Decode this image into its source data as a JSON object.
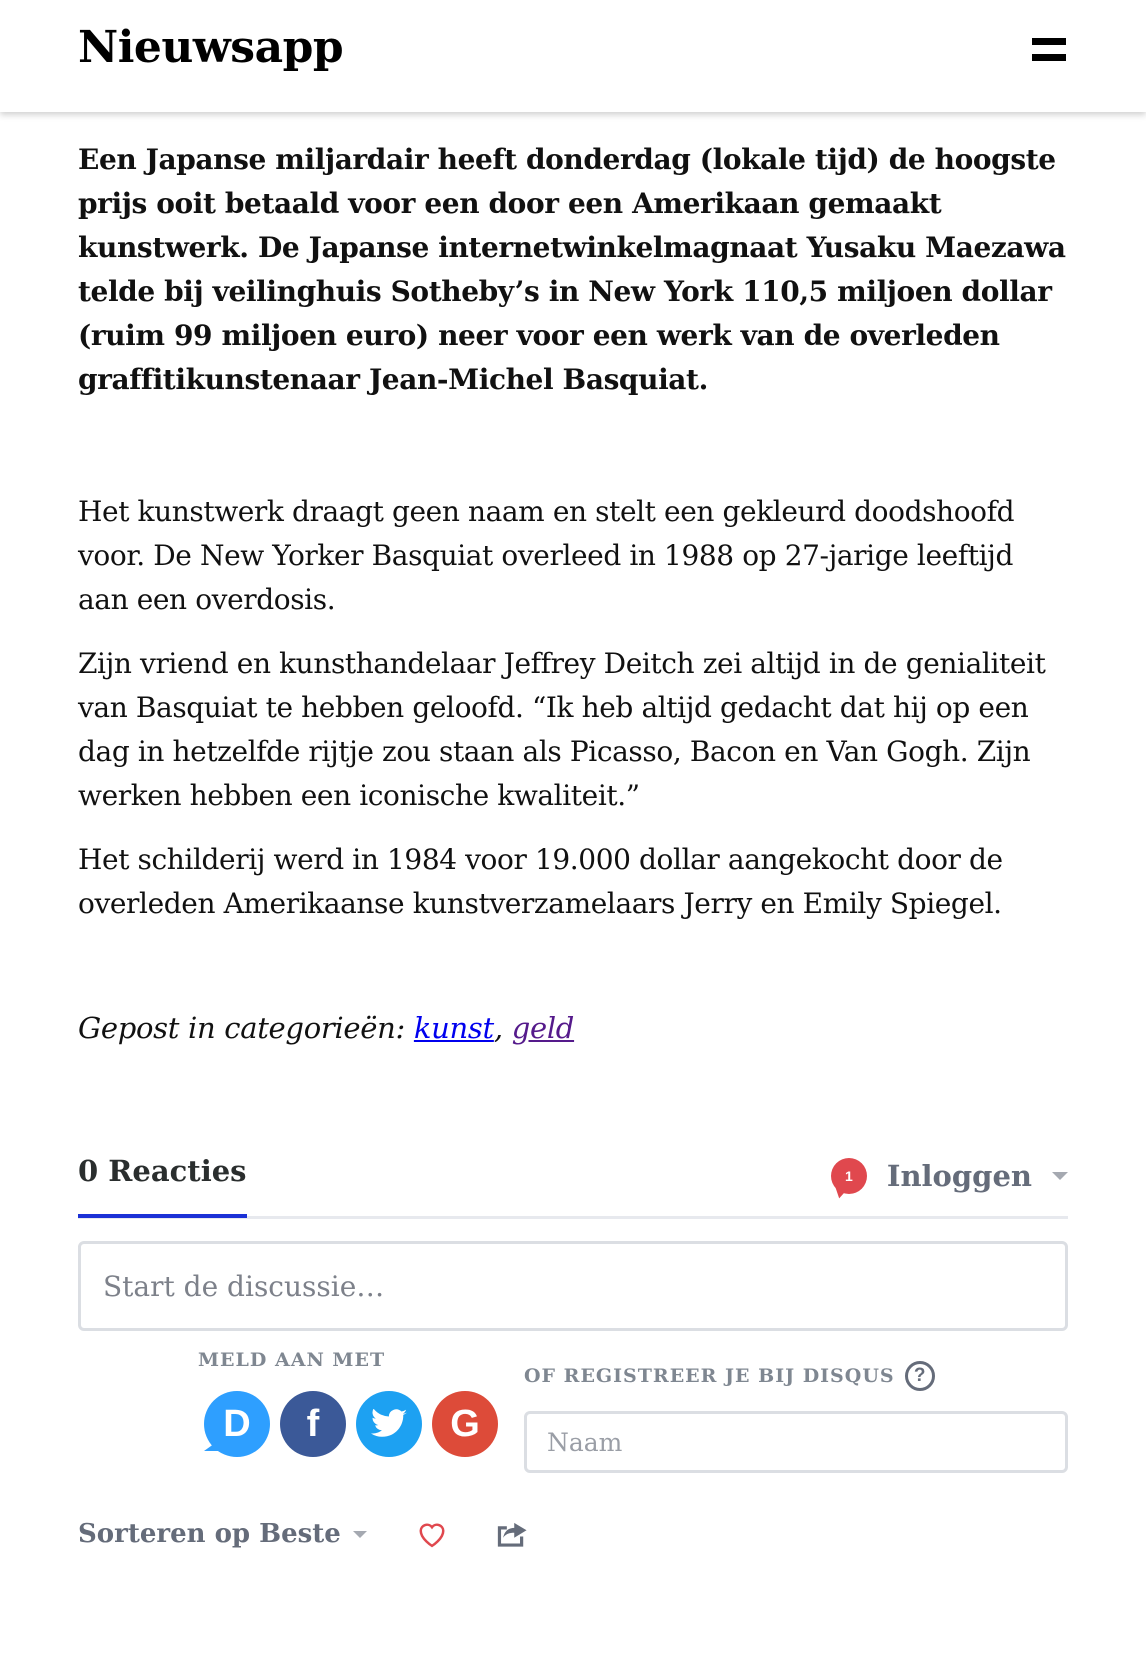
{
  "header": {
    "title": "Nieuwsapp",
    "menu_icon": "menu-icon"
  },
  "article": {
    "lead": "Een Japanse miljardair heeft donderdag (lokale tijd) de hoogste prijs ooit betaald voor een door een Amerikaan gemaakt kunstwerk. De Japanse internetwinkelmagnaat Yusaku Maezawa telde bij veilinghuis Sotheby’s in New York 110,5 miljoen dollar (ruim 99 miljoen euro) neer voor een werk van de overleden graffitikunstenaar Jean-Michel Basquiat.",
    "paragraphs": [
      "Het kunstwerk draagt geen naam en stelt een gekleurd doodshoofd voor. De New Yorker Basquiat overleed in 1988 op 27-jarige leeftijd aan een overdosis.",
      "Zijn vriend en kunsthandelaar Jeffrey Deitch zei altijd in de genialiteit van Basquiat te hebben geloofd. “Ik heb altijd gedacht dat hij op een dag in hetzelfde rijtje zou staan als Picasso, Bacon en Van Gogh. Zijn werken hebben een iconische kwaliteit.”",
      "Het schilderij werd in 1984 voor 19.000 dollar aangekocht door de overleden Amerikaanse kunstverzamelaars Jerry en Emily Spiegel."
    ],
    "categories_prefix": "Gepost in categorieën: ",
    "categories": [
      "kunst",
      "geld"
    ],
    "categories_separator": ", ",
    "link_colors": [
      "#0000ee",
      "#551a8b"
    ]
  },
  "comments": {
    "count": "0",
    "tab_label": "Reacties",
    "notification_count": "1",
    "login_label": "Inloggen",
    "compose_placeholder": "Start de discussie…",
    "login_with_label": "MELD AAN MET",
    "register_label": "OF REGISTREER JE BIJ DISQUS",
    "help_glyph": "?",
    "social_providers": [
      {
        "name": "Disqus",
        "glyph": "D",
        "color": "#2e9fff",
        "icon": "disqus-icon"
      },
      {
        "name": "Facebook",
        "glyph": "f",
        "color": "#3b5998",
        "icon": "facebook-icon"
      },
      {
        "name": "Twitter",
        "glyph": "twitter-bird",
        "color": "#1da1f2",
        "icon": "twitter-icon"
      },
      {
        "name": "Google",
        "glyph": "G",
        "color": "#dd4b39",
        "icon": "google-icon"
      }
    ],
    "name_placeholder": "Naam",
    "sort_label": "Sorteren op Beste",
    "accent_color": "#1b31d6",
    "badge_color": "#e0484e"
  }
}
